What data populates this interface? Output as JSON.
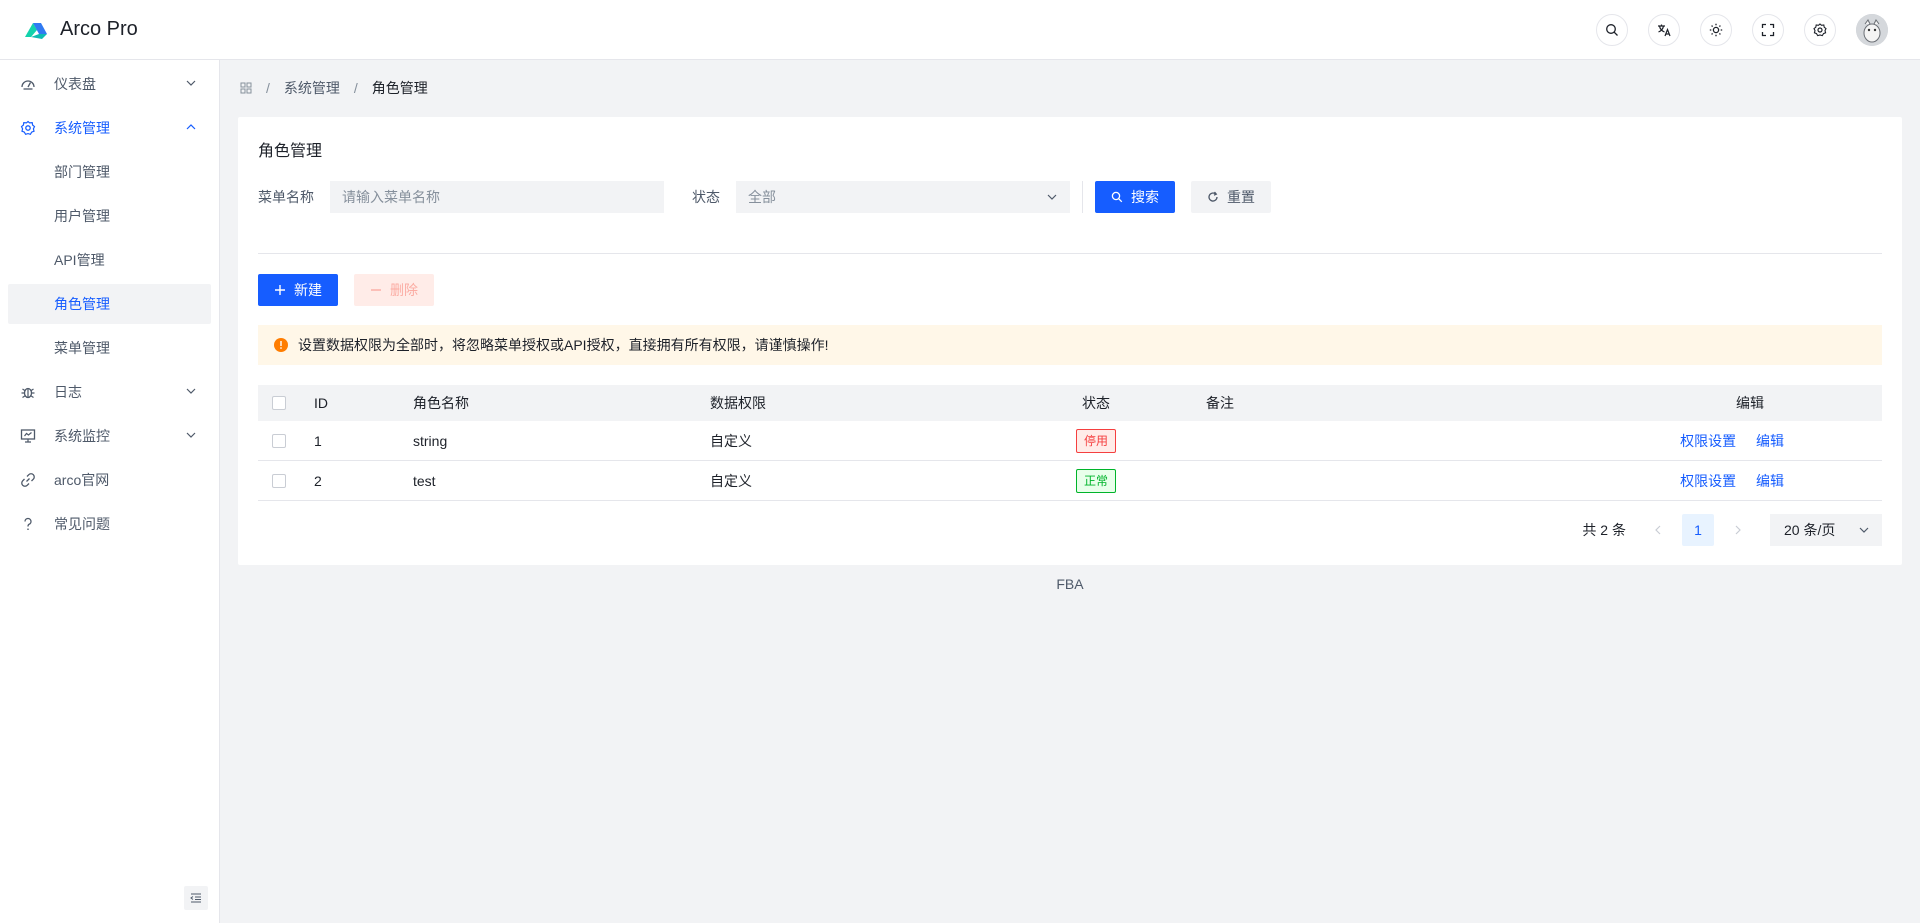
{
  "app": {
    "title": "Arco Pro"
  },
  "header": {
    "icons": [
      "search-icon",
      "language-icon",
      "theme-icon",
      "fullscreen-icon",
      "settings-icon"
    ]
  },
  "sidebar": {
    "items": [
      {
        "label": "仪表盘",
        "icon": "dashboard-icon"
      },
      {
        "label": "系统管理",
        "icon": "gear-icon"
      },
      {
        "label": "日志",
        "icon": "bug-icon"
      },
      {
        "label": "系统监控",
        "icon": "monitor-icon"
      },
      {
        "label": "arco官网",
        "icon": "link-icon"
      },
      {
        "label": "常见问题",
        "icon": "question-icon"
      }
    ],
    "sub_items": [
      "部门管理",
      "用户管理",
      "API管理",
      "角色管理",
      "菜单管理"
    ]
  },
  "breadcrumb": {
    "level1": "系统管理",
    "current": "角色管理"
  },
  "card": {
    "title": "角色管理"
  },
  "filters": {
    "name_label": "菜单名称",
    "name_placeholder": "请输入菜单名称",
    "status_label": "状态",
    "status_value": "全部",
    "search_label": "搜索",
    "reset_label": "重置"
  },
  "actions": {
    "new_label": "新建",
    "delete_label": "删除"
  },
  "alert": {
    "text": "设置数据权限为全部时，将忽略菜单授权或API授权，直接拥有所有权限，请谨慎操作!"
  },
  "table": {
    "headers": {
      "id": "ID",
      "name": "角色名称",
      "perm": "数据权限",
      "status": "状态",
      "remark": "备注",
      "edit": "编辑"
    },
    "rows": [
      {
        "id": "1",
        "name": "string",
        "perm": "自定义",
        "status": "停用",
        "remark": "",
        "perm_link": "权限设置",
        "edit_link": "编辑"
      },
      {
        "id": "2",
        "name": "test",
        "perm": "自定义",
        "status": "正常",
        "remark": "",
        "perm_link": "权限设置",
        "edit_link": "编辑"
      }
    ]
  },
  "pagination": {
    "total": "共 2 条",
    "page": "1",
    "size": "20 条/页"
  },
  "footer": {
    "text": "FBA"
  },
  "colors": {
    "primary": "#165dff",
    "danger": "#f53f3f",
    "success": "#00b42a",
    "warning": "#ff7d00"
  }
}
